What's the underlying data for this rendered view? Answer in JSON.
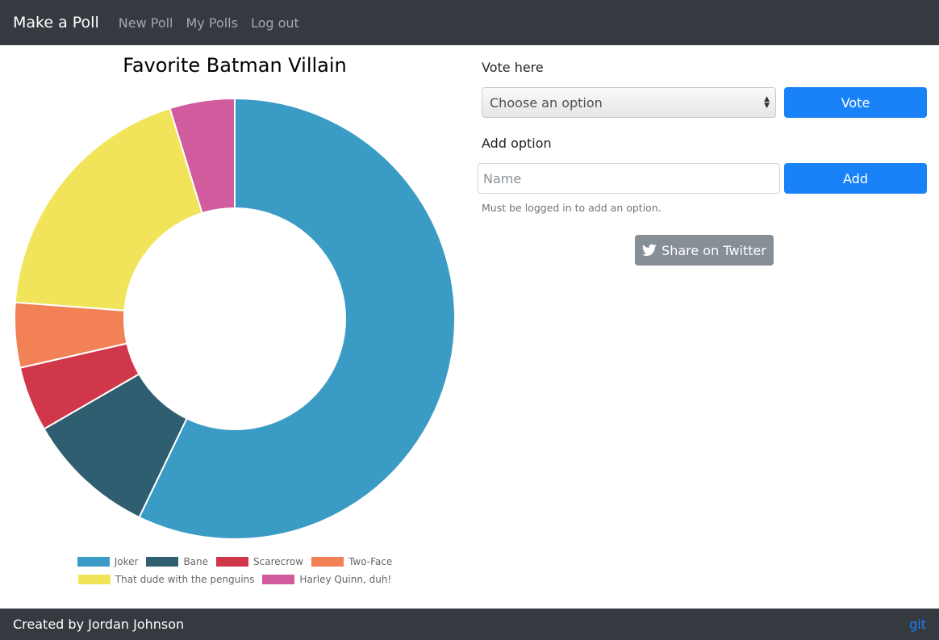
{
  "navbar": {
    "brand": "Make a Poll",
    "links": [
      "New Poll",
      "My Polls",
      "Log out"
    ]
  },
  "poll": {
    "title": "Favorite Batman Villain"
  },
  "vote": {
    "label": "Vote here",
    "select_value": "Choose an option",
    "button": "Vote"
  },
  "add_option": {
    "label": "Add option",
    "placeholder": "Name",
    "button": "Add",
    "help": "Must be logged in to add an option."
  },
  "share": {
    "button": "Share on Twitter",
    "icon": "twitter-bird-icon"
  },
  "footer": {
    "credit": "Created by Jordan Johnson",
    "link": "git"
  },
  "colors": {
    "navbar": "#343a40",
    "primary": "#1a82f7",
    "secondary": "#868e96"
  },
  "chart_data": {
    "type": "pie",
    "variant": "doughnut",
    "title": "Favorite Batman Villain",
    "legend_position": "bottom",
    "categories": [
      "Joker",
      "Bane",
      "Scarecrow",
      "Two-Face",
      "That dude with the penguins",
      "Harley Quinn, duh!"
    ],
    "values": [
      12,
      2,
      1,
      1,
      4,
      1
    ],
    "colors": [
      "#3a9bc4",
      "#2e5e70",
      "#d1374a",
      "#f38156",
      "#f2e45a",
      "#d05b9d"
    ]
  }
}
